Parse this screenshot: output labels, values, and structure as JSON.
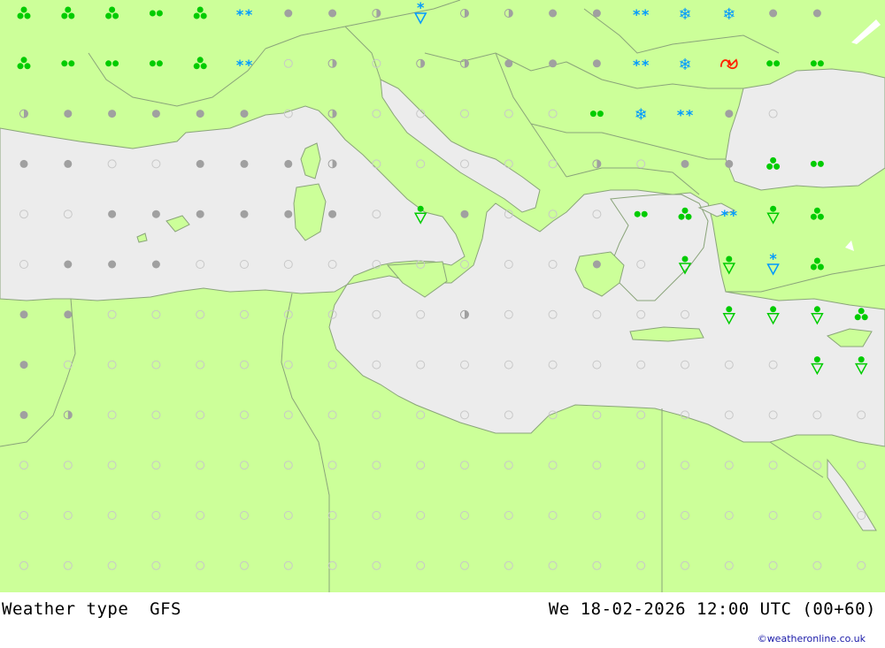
{
  "title": "Weather type  GFS",
  "valid_time": "We 18-02-2026 12:00 UTC (00+60)",
  "credit": "©weatheronline.co.uk",
  "colors": {
    "land": "#ccff99",
    "sea": "#ececec",
    "border": "#8aa47a",
    "rain": "#00cc00",
    "snow": "#0099ff",
    "cloud": "#a0a0a0",
    "clear": "#c8c8c8",
    "thunder": "#ff2200"
  },
  "legend_symbols": {
    "c": "clear-circle",
    "o": "overcast-dot",
    "p": "partly-cloudy-dot",
    "s": "shower-triangle",
    "g": "snow-shower-triangle",
    "r": "rain-dots",
    "R": "heavy-rain-cluster",
    "w": "snow-stars",
    "W": "heavy-snow-flake",
    "t": "thunderstorm"
  },
  "grid_rows": [
    "RRRrRwoopgppoowWWoo",
    "RrrrRwcpcppooowWtrr",
    "pooooocpcccccrWwoc",
    "ooccooopcccccpcooRr",
    "ccoooooocsocccrRwsR",
    "cooocccccccccocssgR",
    "ooccccccccpcccccsssR",
    "occcccccccccccccccss",
    "opcccccccccccccccccc",
    "cccccccccccccccccccc",
    "cccccccccccccccccccc",
    "cccccccccccccccccccc"
  ]
}
